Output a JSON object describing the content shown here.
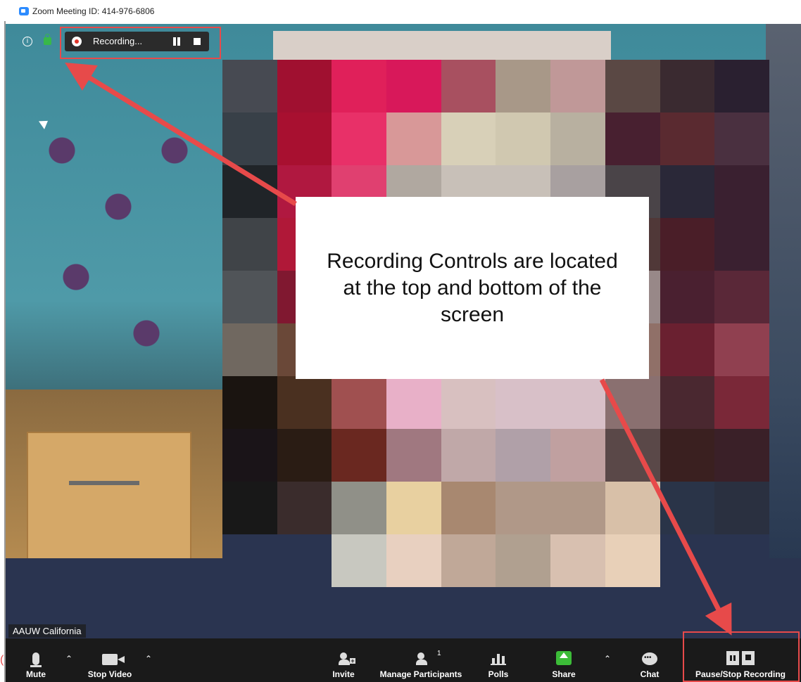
{
  "window": {
    "title": "Zoom Meeting ID: 414-976-6806"
  },
  "top_recording": {
    "label": "Recording...",
    "pause_icon": "pause-icon",
    "stop_icon": "stop-icon"
  },
  "top_icons": {
    "info": "info-icon",
    "lock": "lock-icon"
  },
  "callout": {
    "text": "Recording Controls are located at the top and bottom of the screen"
  },
  "participant": {
    "name": "AAUW California"
  },
  "toolbar": {
    "mute": "Mute",
    "stop_video": "Stop Video",
    "invite": "Invite",
    "manage_participants": "Manage Participants",
    "participant_count": "1",
    "polls": "Polls",
    "share": "Share",
    "chat": "Chat",
    "pause_stop_recording": "Pause/Stop Recording"
  },
  "colors": {
    "annotation_red": "#e74a4a",
    "share_green": "#3cbc38",
    "record_red": "#e0352b",
    "toolbar_bg": "#1a1a1a"
  },
  "pixelated_face_colors": [
    "#474a52",
    "#a01030",
    "#e0205a",
    "#d8185a",
    "#a85060",
    "#a89888",
    "#c09898",
    "#5a4844",
    "#3a2a30",
    "#2a2030",
    "#384048",
    "#a81030",
    "#e83068",
    "#d89898",
    "#d8d0b8",
    "#d0c8b0",
    "#b8b0a0",
    "#482030",
    "#5a2a30",
    "#4a3040",
    "#202428",
    "#b01840",
    "#e04070",
    "#b0a8a0",
    "#c8c0b8",
    "#c8c0b8",
    "#a8a0a0",
    "#4a4448",
    "#2a2838",
    "#3a2030",
    "#404448",
    "#b01838",
    "#d84068",
    "#d0b0b0",
    "#e8e0d8",
    "#e8e0d8",
    "#c0b0b0",
    "#503838",
    "#4a1e28",
    "#3a2030",
    "#505458",
    "#801830",
    "#c03050",
    "#e0c8c0",
    "#f0e8e0",
    "#f0e8e8",
    "#e8d8d8",
    "#988888",
    "#4a2030",
    "#5a2838",
    "#706860",
    "#6a4838",
    "#b84058",
    "#e8d8c8",
    "#f0e0d8",
    "#f8ecec",
    "#f0e0e0",
    "#907068",
    "#6a2030",
    "#904050",
    "#1a1410",
    "#4a3020",
    "#a05050",
    "#e8b0c8",
    "#d8c0c0",
    "#d8c0c8",
    "#d8c0c8",
    "#8a7070",
    "#4a2830",
    "#7a2838",
    "#1a1418",
    "#2a1c14",
    "#6a2820",
    "#a07880",
    "#c0a8a8",
    "#b0a0a8",
    "#c0a0a0",
    "#5a4848",
    "#3a2020",
    "#3a2028",
    "#181818",
    "#3a2c2c",
    "#909088",
    "#e8d0a0",
    "#a88870",
    "#b09888",
    "#b09888",
    "#d8c0a8",
    "#2a3448",
    "#2a3040",
    "#2a3450",
    "#2a3450",
    "#c8c8c0",
    "#e8d0c0",
    "#c0a898",
    "#b0a090",
    "#d8c0b0",
    "#e8d0b8",
    "#2a3450",
    "#2a3450"
  ]
}
